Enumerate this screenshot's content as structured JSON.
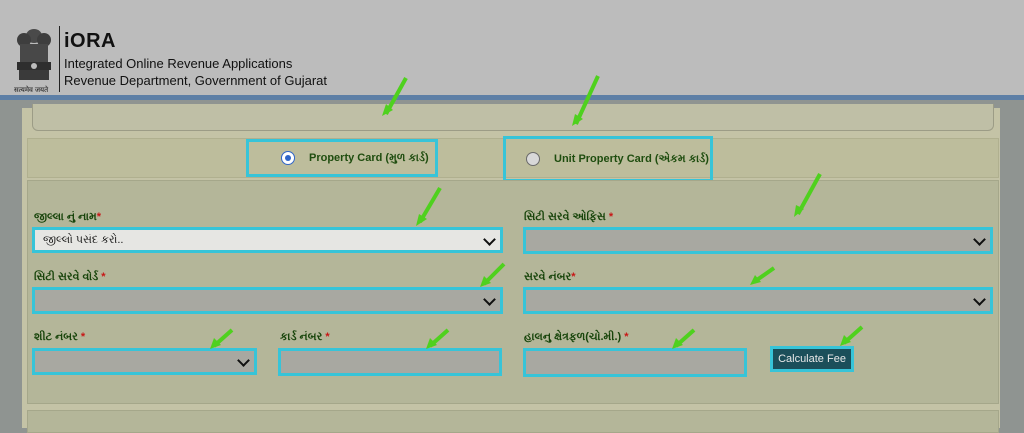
{
  "header": {
    "brand": "iORA",
    "subtitle_1": "Integrated Online Revenue Applications",
    "subtitle_2": "Revenue Department, Government of Gujarat",
    "emblem_caption": "सत्यमेव जयते"
  },
  "radios": [
    {
      "label": "Property Card (મુળ કાર્ડ)",
      "checked": true
    },
    {
      "label": "Unit Property Card (એકમ કાર્ડ)",
      "checked": false
    }
  ],
  "form": {
    "district": {
      "label": "જીલ્લા નું નામ",
      "value": "જીલ્લો પસંદ કરો.."
    },
    "city_survey_office": {
      "label": "સિટી સરવે ઓફિસ",
      "value": ""
    },
    "city_survey_ward": {
      "label": "સિટી સરવે વોર્ડ",
      "value": ""
    },
    "survey_number": {
      "label": "સરવે નંબર",
      "value": ""
    },
    "sheet_number": {
      "label": "શીટ નંબર",
      "value": ""
    },
    "card_number": {
      "label": "કાર્ડ નંબર",
      "value": ""
    },
    "current_area": {
      "label": "હાલનુ ક્ષેત્રફળ(ચો.મી.)",
      "value": ""
    },
    "required_mark": "*",
    "calculate_button": "Calculate Fee"
  },
  "colors": {
    "highlight": "#37c4d8",
    "arrow": "#4fd11e",
    "label_text": "#17440a",
    "required": "#c81616",
    "button_bg": "#1b4f5a",
    "header_rule": "#5d7fa6"
  }
}
